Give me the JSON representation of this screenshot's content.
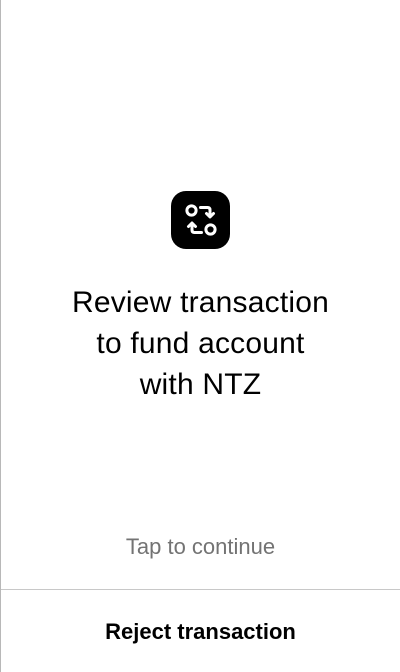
{
  "screen": {
    "icon": "transaction-swap-icon",
    "title_lines": [
      "Review transaction",
      "to fund account",
      "with NTZ"
    ],
    "hint": "Tap to continue",
    "reject_label": "Reject transaction"
  },
  "colors": {
    "background": "#ffffff",
    "icon_badge": "#000000",
    "hint_text": "#737373",
    "divider": "#c8c8c8"
  }
}
